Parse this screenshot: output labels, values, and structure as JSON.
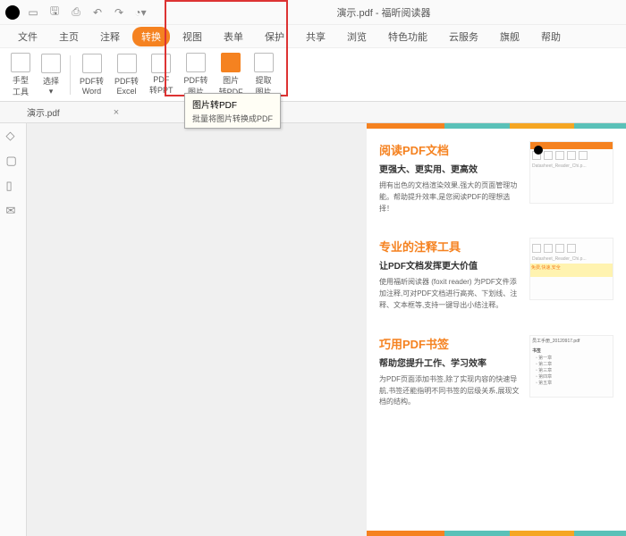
{
  "titlebar": {
    "title": "演示.pdf - 福昕阅读器"
  },
  "menubar": {
    "items": [
      "文件",
      "主页",
      "注释",
      "转换",
      "视图",
      "表单",
      "保护",
      "共享",
      "浏览",
      "特色功能",
      "云服务",
      "旗舰",
      "帮助"
    ],
    "active_index": 3
  },
  "ribbon": {
    "left": [
      {
        "label1": "手型",
        "label2": "工具"
      },
      {
        "label1": "选择",
        "label2": ""
      }
    ],
    "convert": [
      {
        "label1": "PDF转",
        "label2": "Word"
      },
      {
        "label1": "PDF转",
        "label2": "Excel"
      },
      {
        "label1": "PDF",
        "label2": "转PPT"
      },
      {
        "label1": "PDF转",
        "label2": "图片"
      },
      {
        "label1": "图片",
        "label2": "转PDF"
      },
      {
        "label1": "提取",
        "label2": "图片"
      }
    ],
    "highlight_index": 4
  },
  "tooltip": {
    "title": "图片转PDF",
    "desc": "批量将图片转换成PDF"
  },
  "tab": {
    "name": "演示.pdf",
    "close": "×"
  },
  "sidebar_icons": [
    "tag",
    "bookmark",
    "page",
    "comment"
  ],
  "sections": [
    {
      "h1": "阅读PDF文档",
      "h2": "更强大、更实用、更高效",
      "p": "拥有出色的文档渲染效果,强大的页面管理功能。帮助提升效率,是您阅读PDF的理想选择！"
    },
    {
      "h1": "专业的注释工具",
      "h2": "让PDF文档发挥更大价值",
      "p": "使用福昕阅读器 (foxit reader) 为PDF文件添加注释,可对PDF文档进行高亮、下划线、注释、文本框等,支持一键导出小结注释。"
    },
    {
      "h1": "巧用PDF书签",
      "h2": "帮助您提升工作、学习效率",
      "p": "为PDF页面添加书签,除了实现内容的快速导航,书签还能指明不同书签的层级关系,展现文档的结构。"
    }
  ],
  "thumb2": {
    "badge": "免费,快速,安全"
  },
  "thumb3": {
    "title": "员工手册_20120917.pdf",
    "sub": "书签"
  }
}
